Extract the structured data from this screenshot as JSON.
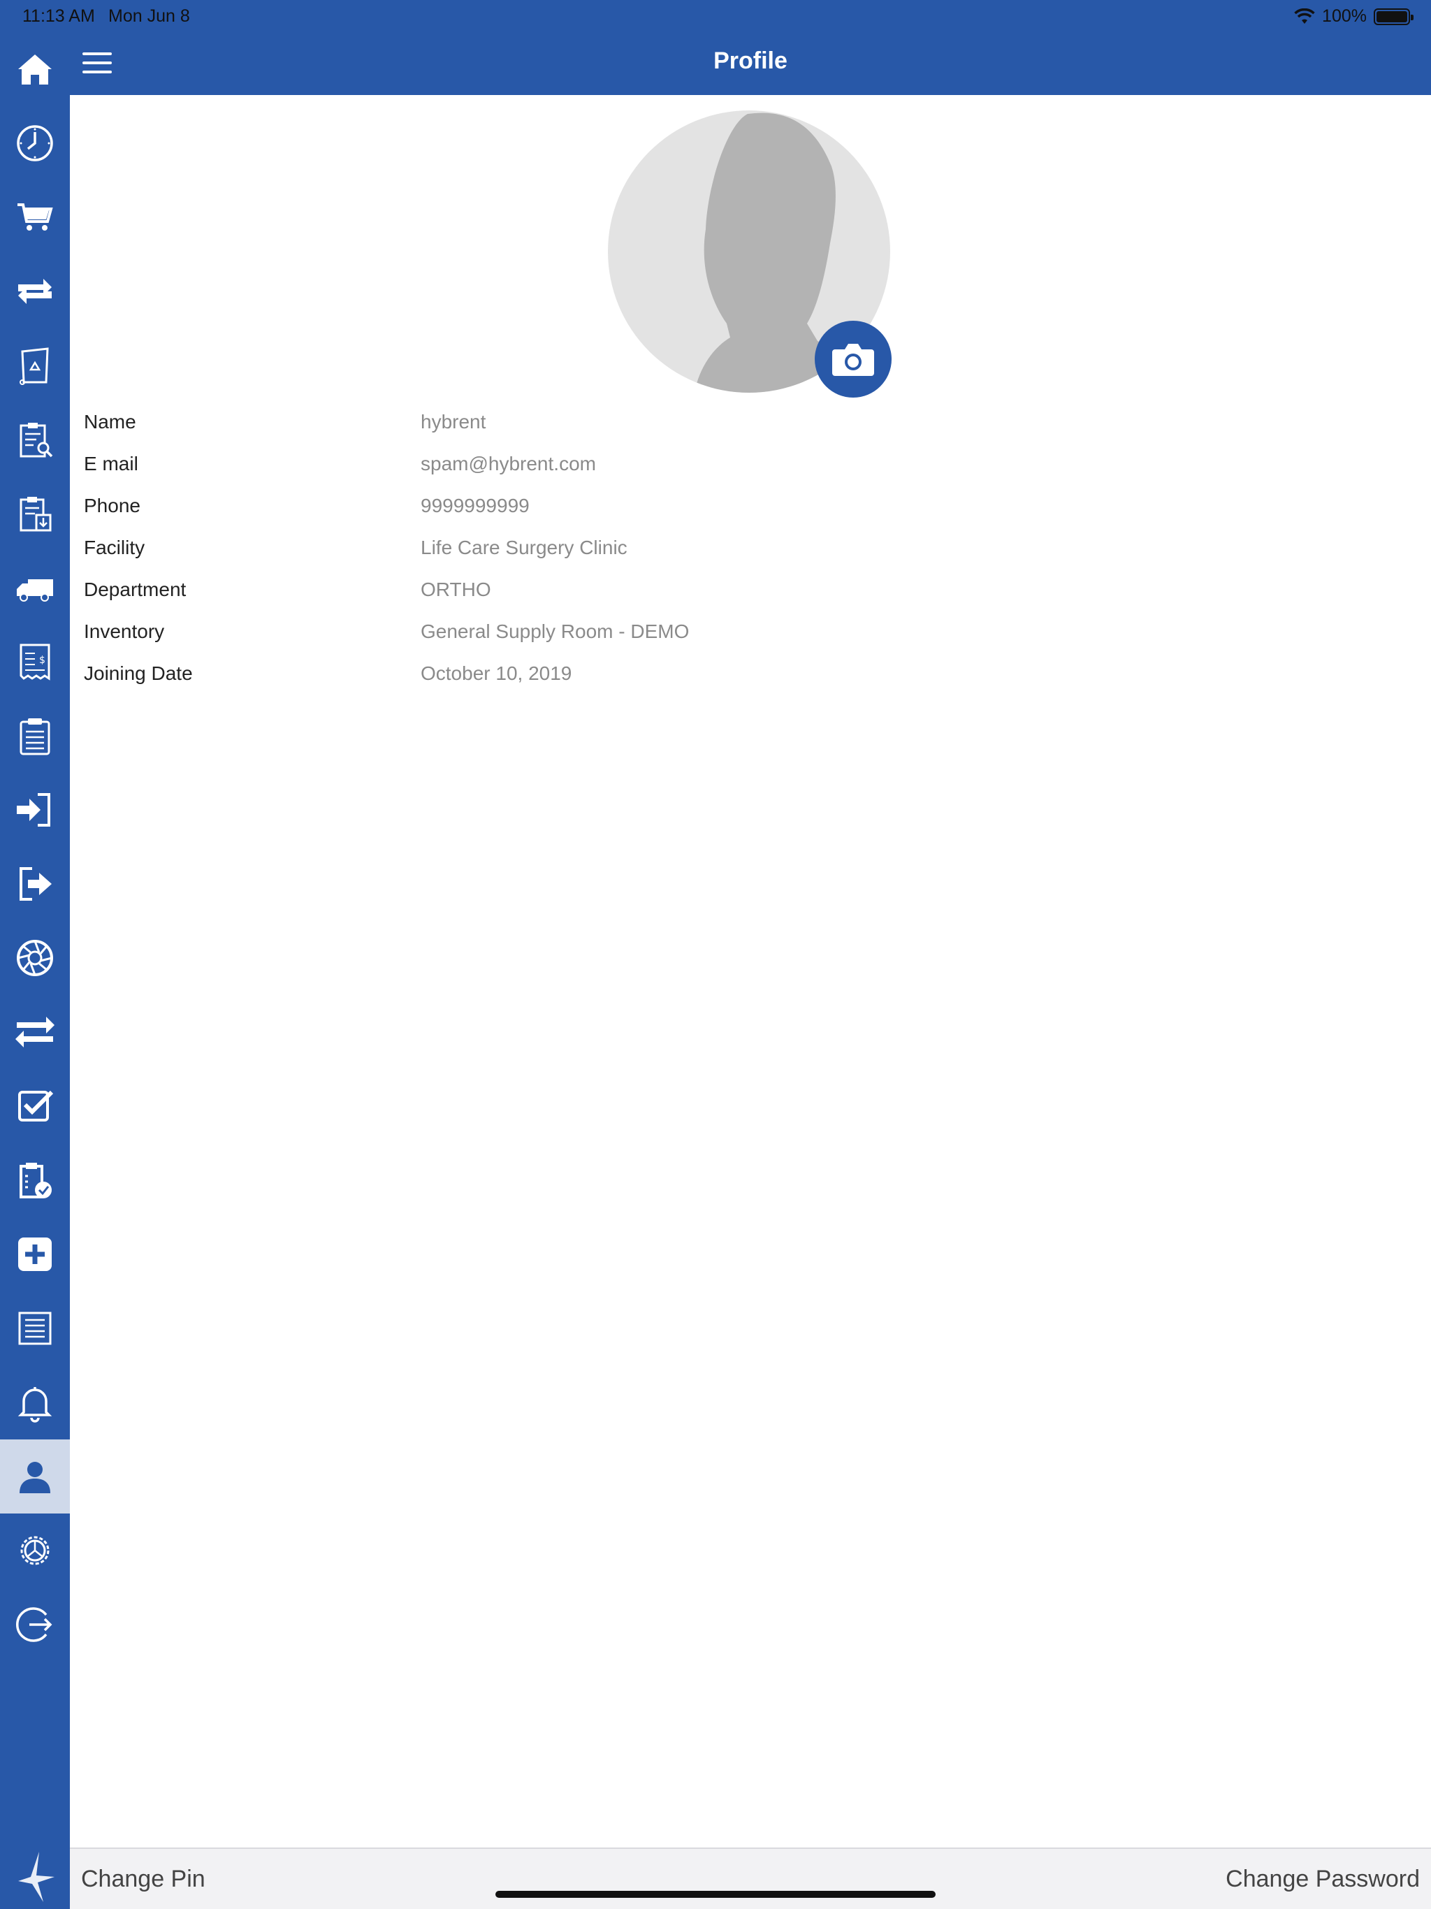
{
  "status_bar": {
    "time": "11:13 AM",
    "date": "Mon Jun 8",
    "battery": "100%"
  },
  "header": {
    "title": "Profile"
  },
  "sidebar": {
    "items": [
      {
        "icon": "home-icon"
      },
      {
        "icon": "clock-icon"
      },
      {
        "icon": "cart-icon"
      },
      {
        "icon": "swap-icon"
      },
      {
        "icon": "recycle-icon"
      },
      {
        "icon": "clipboard-search-icon"
      },
      {
        "icon": "clipboard-download-icon"
      },
      {
        "icon": "truck-icon"
      },
      {
        "icon": "invoice-icon"
      },
      {
        "icon": "clipboard-list-icon"
      },
      {
        "icon": "sign-in-icon"
      },
      {
        "icon": "sign-out-icon"
      },
      {
        "icon": "aperture-icon"
      },
      {
        "icon": "transfer-arrows-icon"
      },
      {
        "icon": "checkbox-icon"
      },
      {
        "icon": "clipboard-check-icon"
      },
      {
        "icon": "plus-square-icon"
      },
      {
        "icon": "list-document-icon"
      },
      {
        "icon": "bell-icon"
      },
      {
        "icon": "user-icon",
        "active": true
      },
      {
        "icon": "gear-icon"
      },
      {
        "icon": "logout-icon"
      }
    ],
    "accent": "#2858a8"
  },
  "profile": {
    "fields": [
      {
        "label": "Name",
        "value": "hybrent"
      },
      {
        "label": "E mail",
        "value": "spam@hybrent.com"
      },
      {
        "label": "Phone",
        "value": "9999999999"
      },
      {
        "label": "Facility",
        "value": "Life Care Surgery Clinic"
      },
      {
        "label": "Department",
        "value": "ORTHO"
      },
      {
        "label": "Inventory",
        "value": "General Supply Room - DEMO"
      },
      {
        "label": "Joining Date",
        "value": "October 10, 2019"
      }
    ]
  },
  "footer": {
    "change_pin": "Change Pin",
    "change_password": "Change Password"
  }
}
